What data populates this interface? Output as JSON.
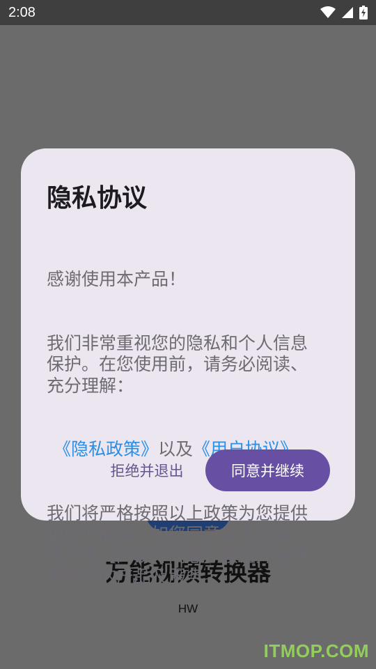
{
  "status_bar": {
    "time": "2:08",
    "icons": [
      "wifi-icon",
      "cell-signal-icon",
      "battery-charging-icon"
    ]
  },
  "background": {
    "app_title": "万能视频转换器",
    "app_subtitle": "HW"
  },
  "dialog": {
    "title": "隐私协议",
    "body_lines": [
      "感谢使用本产品！",
      "我们非常重视您的隐私和个人信息保护。在您使用前，请务必阅读、充分理解："
    ],
    "privacy_policy_link": "《隐私政策》",
    "and_text": "以及",
    "user_agreement_link": "《用户协议》",
    "closing_text": "我们将严格按照以上政策为您提供更好的服务。如您同意以上政策，请点击【阅读并同意】按钮开始使用我们的产品及服务。",
    "reject_label": "拒绝并退出",
    "agree_label": "同意并继续"
  },
  "watermark": "ITMOP.COM",
  "colors": {
    "scrim": "#6b6b6b",
    "dialog_bg": "#ece6f0",
    "primary": "#6750a4",
    "link": "#2b8fe6"
  }
}
